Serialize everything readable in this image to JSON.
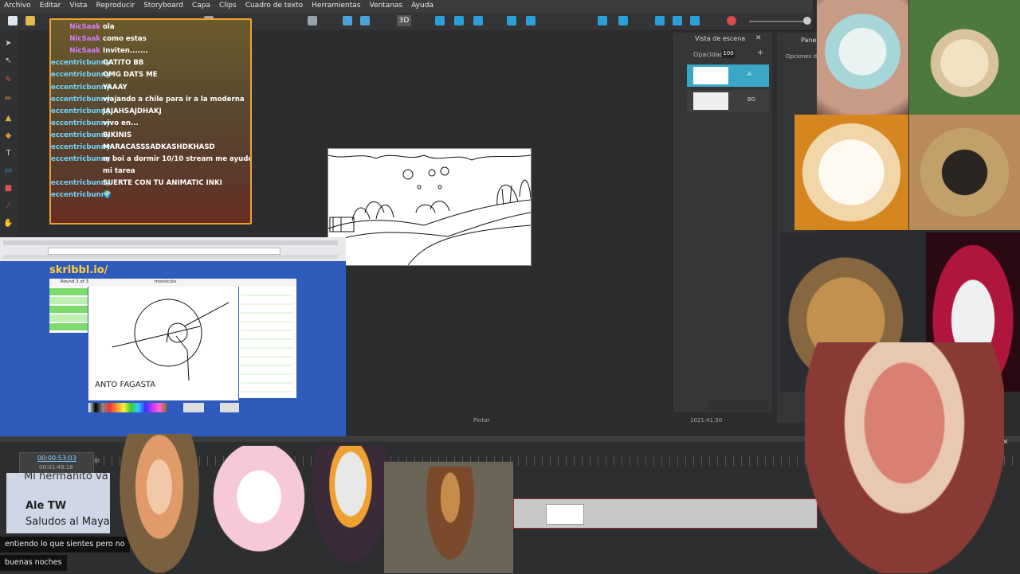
{
  "menu": [
    "Archivo",
    "Editar",
    "Vista",
    "Reproducir",
    "Storyboard",
    "Capa",
    "Clips",
    "Cuadro de texto",
    "Herramientas",
    "Ventanas",
    "Ayuda"
  ],
  "toolbar": {
    "mode_3d": "3D"
  },
  "chat": {
    "messages": [
      {
        "user": "NicSaak",
        "text": "ola",
        "color": "#d67cff"
      },
      {
        "user": "NicSaak",
        "text": "como estas",
        "color": "#d67cff"
      },
      {
        "user": "NicSaak",
        "text": "Inviten.......",
        "color": "#d67cff"
      },
      {
        "user": "eccentricbunny",
        "text": "GATITO BB",
        "color": "#6fd6ff"
      },
      {
        "user": "eccentricbunny",
        "text": "OMG DATS ME",
        "color": "#6fd6ff"
      },
      {
        "user": "eccentricbunny",
        "text": "YAAAY",
        "color": "#6fd6ff"
      },
      {
        "user": "eccentricbunny",
        "text": "viajando a chile para ir a la moderna",
        "color": "#6fd6ff"
      },
      {
        "user": "eccentricbunny",
        "text": "JAJAHSAJDHAKJ",
        "color": "#6fd6ff"
      },
      {
        "user": "eccentricbunny",
        "text": "vivo en...",
        "color": "#6fd6ff"
      },
      {
        "user": "eccentricbunny",
        "text": "BIKINIS",
        "color": "#6fd6ff"
      },
      {
        "user": "eccentricbunny",
        "text": "MARACASSSADKASHDKHASD",
        "color": "#6fd6ff"
      },
      {
        "user": "eccentricbunny",
        "text": "m boi a dormir 10/10 stream me ayudó a hacer",
        "color": "#6fd6ff"
      },
      {
        "user": "",
        "text": "mi tarea",
        "color": "#6fd6ff"
      },
      {
        "user": "eccentricbunny",
        "text": "SUERTE CON TU ANIMATIC INKI",
        "color": "#6fd6ff"
      },
      {
        "user": "eccentricbunny",
        "text": "🌍",
        "color": "#6fd6ff"
      }
    ]
  },
  "scene_panel": {
    "title": "Vista de escena",
    "opacity_label": "Opacidad",
    "opacity_value": "100",
    "layers": [
      {
        "name": "A"
      },
      {
        "name": "BG"
      }
    ]
  },
  "panel2": {
    "title": "Panel",
    "subtitle": "Opciones de"
  },
  "skribbl": {
    "logo": "skribbl.io/",
    "round": "Round 3 of 3",
    "word": "monóculo",
    "drawing_text": "ANTO FAGASTA"
  },
  "status": {
    "tool": "Pintar",
    "coords": "1021:41.50"
  },
  "timeline": {
    "timecode": "00:00:53:03",
    "duration": "00:01:49:18",
    "frame": "00"
  },
  "ticker": {
    "line1": "Mi hermanito va",
    "name": "Ale TW",
    "line2": "Saludos al Maya"
  },
  "bottom_chat": [
    "entiendo lo que sientes pero no",
    "buenas noches"
  ],
  "colors": {
    "chat_border": "#f0a030",
    "accent": "#3aa7c7",
    "timeline_mark": "#a03030"
  }
}
